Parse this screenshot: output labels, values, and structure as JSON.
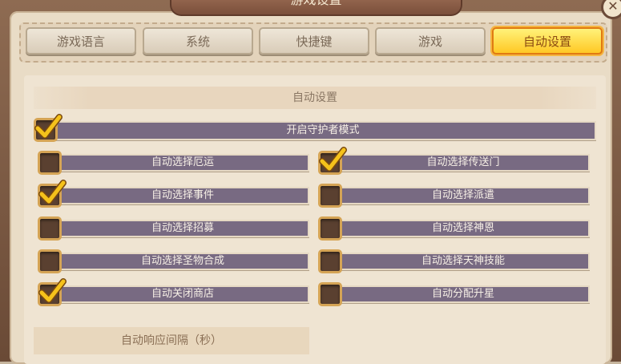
{
  "window": {
    "title": "游戏设置",
    "close_glyph": "✕"
  },
  "tabs": [
    {
      "label": "游戏语言",
      "active": false
    },
    {
      "label": "系统",
      "active": false
    },
    {
      "label": "快捷键",
      "active": false
    },
    {
      "label": "游戏",
      "active": false
    },
    {
      "label": "自动设置",
      "active": true
    }
  ],
  "auto_settings": {
    "header": "自动设置",
    "guardian_mode": {
      "label": "开启守护者模式",
      "checked": true
    },
    "left_options": [
      {
        "label": "自动选择厄运",
        "checked": false
      },
      {
        "label": "自动选择事件",
        "checked": true
      },
      {
        "label": "自动选择招募",
        "checked": false
      },
      {
        "label": "自动选择圣物合成",
        "checked": false
      },
      {
        "label": "自动关闭商店",
        "checked": true
      }
    ],
    "right_options": [
      {
        "label": "自动选择传送门",
        "checked": true
      },
      {
        "label": "自动选择派遣",
        "checked": false
      },
      {
        "label": "自动选择神恩",
        "checked": false
      },
      {
        "label": "自动选择天神技能",
        "checked": false
      },
      {
        "label": "自动分配升星",
        "checked": false
      }
    ],
    "interval_header": "自动响应间隔（秒）"
  },
  "colors": {
    "checkmark": "#f5c21b",
    "active_tab": "#ffd43a",
    "option_bar": "#786a82"
  }
}
